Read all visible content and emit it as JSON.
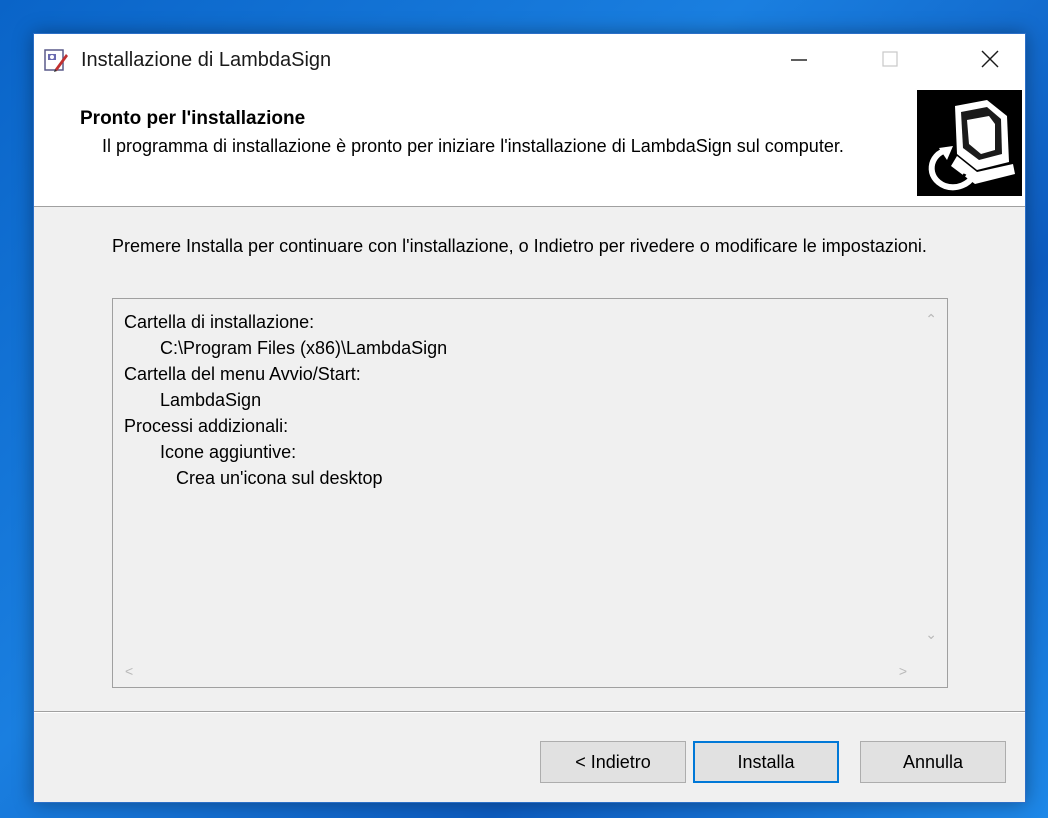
{
  "window": {
    "title": "Installazione di LambdaSign"
  },
  "header": {
    "title": "Pronto per l'installazione",
    "description": "Il programma di installazione è pronto per iniziare l'installazione di LambdaSign sul computer."
  },
  "main": {
    "instructions": "Premere Installa per continuare con l'installazione, o Indietro per rivedere o modificare le impostazioni.",
    "memo": {
      "install_folder_label": "Cartella di installazione:",
      "install_folder_value": "C:\\Program Files (x86)\\LambdaSign",
      "start_menu_label": "Cartella del menu Avvio/Start:",
      "start_menu_value": "LambdaSign",
      "tasks_label": "Processi addizionali:",
      "tasks_group": "Icone aggiuntive:",
      "tasks_item": "Crea un'icona sul desktop"
    }
  },
  "buttons": {
    "back": "< Indietro",
    "install": "Installa",
    "cancel": "Annulla"
  },
  "icons": {
    "app": "installer-icon",
    "minimize": "minimize-icon",
    "maximize": "maximize-icon",
    "close": "close-icon",
    "header_image": "computer-install-icon"
  },
  "colors": {
    "desktop_bg": "#0a64c8",
    "window_bg": "#f0f0f0",
    "header_bg": "#ffffff",
    "focus_border": "#0078d7"
  }
}
